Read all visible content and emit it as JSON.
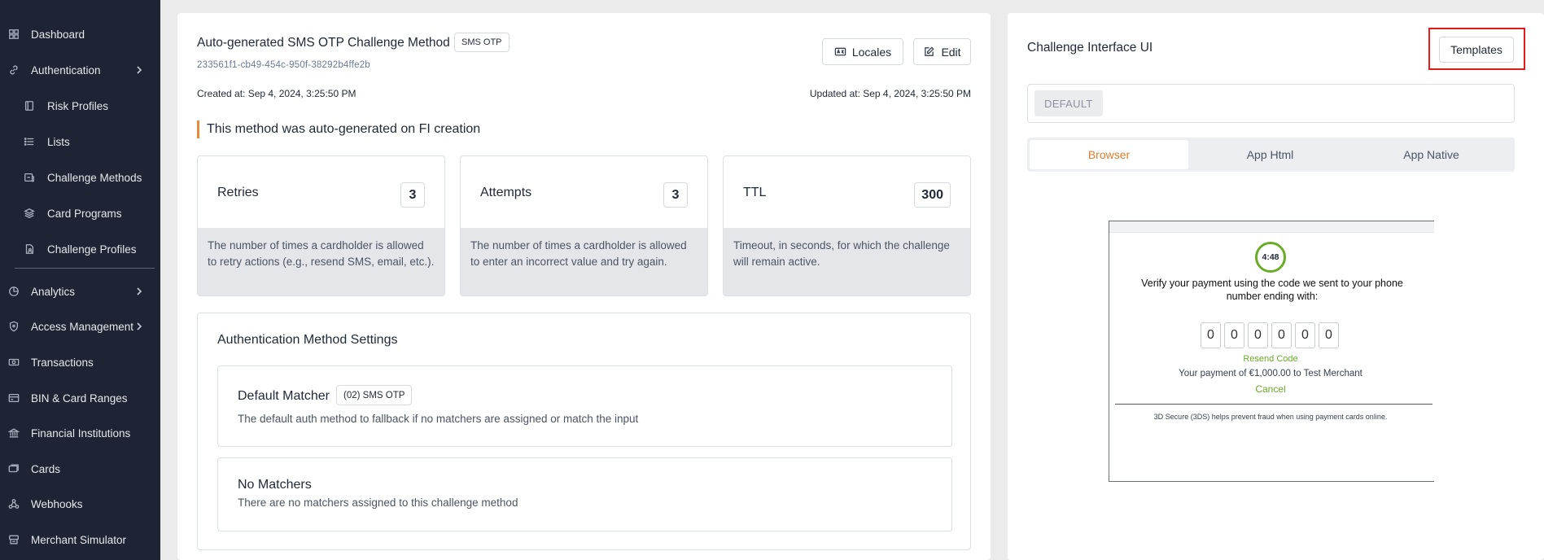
{
  "sidebar": {
    "items": [
      {
        "label": "Dashboard",
        "icon": "dashboard-icon"
      },
      {
        "label": "Authentication",
        "icon": "link-icon",
        "expandable": true
      },
      {
        "label": "Risk Profiles",
        "icon": "risk-profiles-icon"
      },
      {
        "label": "Lists",
        "icon": "list-icon"
      },
      {
        "label": "Challenge Methods",
        "icon": "challenge-methods-icon"
      },
      {
        "label": "Card Programs",
        "icon": "layers-icon"
      },
      {
        "label": "Challenge Profiles",
        "icon": "file-user-icon"
      },
      {
        "label": "Analytics",
        "icon": "analytics-icon",
        "expandable": true
      },
      {
        "label": "Access Management",
        "icon": "shield-icon",
        "expandable": true
      },
      {
        "label": "Transactions",
        "icon": "money-icon"
      },
      {
        "label": "BIN & Card Ranges",
        "icon": "card-ranges-icon"
      },
      {
        "label": "Financial Institutions",
        "icon": "bank-icon"
      },
      {
        "label": "Cards",
        "icon": "cards-icon"
      },
      {
        "label": "Webhooks",
        "icon": "webhook-icon"
      },
      {
        "label": "Merchant Simulator",
        "icon": "register-icon"
      }
    ]
  },
  "method": {
    "title": "Auto-generated SMS OTP Challenge Method",
    "type_badge": "SMS OTP",
    "uuid": "233561f1-cb49-454c-950f-38292b4ffe2b",
    "created": "Created at: Sep 4, 2024, 3:25:50 PM",
    "updated": "Updated at: Sep 4, 2024, 3:25:50 PM",
    "locales_label": "Locales",
    "edit_label": "Edit",
    "notice": "This method was auto-generated on FI creation"
  },
  "stats": [
    {
      "name": "Retries",
      "value": "3",
      "desc": "The number of times a cardholder is allowed to retry actions (e.g., resend SMS, email, etc.)."
    },
    {
      "name": "Attempts",
      "value": "3",
      "desc": "The number of times a cardholder is allowed to enter an incorrect value and try again."
    },
    {
      "name": "TTL",
      "value": "300",
      "desc": "Timeout, in seconds, for which the challenge will remain active."
    }
  ],
  "settings": {
    "title": "Authentication Method Settings",
    "default_matcher": {
      "title": "Default Matcher",
      "badge": "(02) SMS OTP",
      "desc": "The default auth method to fallback if no matchers are assigned or match the input"
    },
    "no_matchers": {
      "title": "No Matchers",
      "desc": "There are no matchers assigned to this challenge method"
    }
  },
  "challenge_ui": {
    "title": "Challenge Interface UI",
    "templates_label": "Templates",
    "default_label": "DEFAULT",
    "tabs": [
      "Browser",
      "App Html",
      "App Native"
    ],
    "active_tab": "Browser",
    "preview": {
      "timer": "4:48",
      "message": "Verify your payment using the code we sent to your phone number ending with:",
      "digits": [
        "0",
        "0",
        "0",
        "0",
        "0",
        "0"
      ],
      "resend": "Resend Code",
      "payment": "Your payment of €1,000.00 to Test Merchant",
      "cancel": "Cancel",
      "footer": "3D Secure (3DS) helps prevent fraud when using payment cards online."
    }
  },
  "colors": {
    "sidebar_bg": "#1e2433",
    "accent_orange": "#e07d2d",
    "accent_green": "#6aab27",
    "highlight_red": "#e31b1b"
  }
}
